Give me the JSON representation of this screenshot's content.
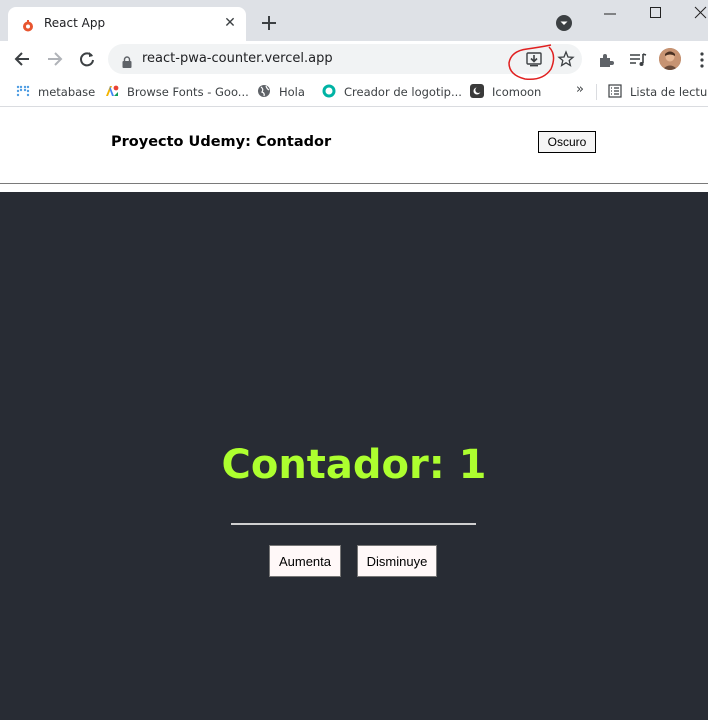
{
  "browser": {
    "tab_title": "React App",
    "url": "react-pwa-counter.vercel.app",
    "bookmarks": [
      {
        "label": "metabase",
        "icon": "metabase-icon"
      },
      {
        "label": "Browse Fonts - Goo...",
        "icon": "google-fonts-icon"
      },
      {
        "label": "Hola",
        "icon": "globe-icon"
      },
      {
        "label": "Creador de logotip...",
        "icon": "logo-maker-icon"
      },
      {
        "label": "Icomoon",
        "icon": "icomoon-icon"
      }
    ],
    "overflow_label": "»",
    "reading_list_label": "Lista de lectura"
  },
  "app": {
    "title": "Proyecto Udemy: Contador",
    "theme_button_label": "Oscuro",
    "counter_label": "Contador: 1",
    "increase_label": "Aumenta",
    "decrease_label": "Disminuye"
  },
  "colors": {
    "dark_background": "#282c34",
    "counter_text": "#adff2f",
    "annotation_circle": "#e02020"
  }
}
